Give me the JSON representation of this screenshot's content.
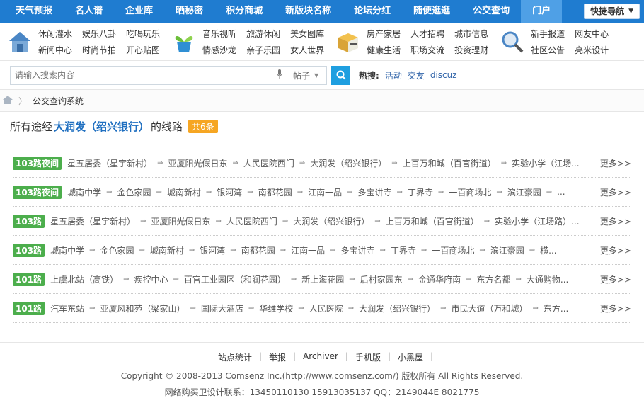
{
  "topnav": {
    "items": [
      "天气预报",
      "名人谱",
      "企业库",
      "晒秘密",
      "积分商城",
      "新版块名称",
      "论坛分红",
      "随便逛逛",
      "公交查询",
      "门户"
    ],
    "quicknav": "快捷导航"
  },
  "categories": [
    {
      "icon": "home-icon",
      "links": [
        "休闲灌水",
        "娱乐八卦",
        "吃喝玩乐",
        "新闻中心",
        "时尚节拍",
        "开心贴图"
      ]
    },
    {
      "icon": "plant-icon",
      "links": [
        "音乐视听",
        "旅游休闲",
        "美女图库",
        "情感沙龙",
        "亲子乐园",
        "女人世界"
      ]
    },
    {
      "icon": "box-icon",
      "links": [
        "房产家居",
        "人才招聘",
        "城市信息",
        "健康生活",
        "职场交流",
        "投资理财"
      ]
    },
    {
      "icon": "magnifier-icon",
      "links": [
        "新手报道",
        "网友中心",
        "社区公告",
        "亮米设计"
      ]
    }
  ],
  "search": {
    "placeholder": "请输入搜索内容",
    "type": "帖子",
    "hot_label": "热搜:",
    "hot": [
      "活动",
      "交友",
      "discuz"
    ]
  },
  "breadcrumb": {
    "current": "公交查询系统"
  },
  "title": {
    "prefix": "所有途经",
    "stop": "大润发（绍兴银行）",
    "suffix": "的线路",
    "count": "共6条"
  },
  "more_label": "更多>>",
  "routes": [
    {
      "name": "103路夜间",
      "stops": [
        "星五居委（星宇新村）",
        "亚厦阳光假日东",
        "人民医院西门",
        "大润发（绍兴银行）",
        "上百万和城（百官街道）",
        "实验小学（江场..."
      ]
    },
    {
      "name": "103路夜间",
      "stops": [
        "城南中学",
        "金色家园",
        "城南新村",
        "银河湾",
        "南都花园",
        "江南一品",
        "多宝讲寺",
        "丁界寺",
        "一百商场北",
        "滨江豪园",
        "..."
      ]
    },
    {
      "name": "103路",
      "stops": [
        "星五居委（星宇新村）",
        "亚厦阳光假日东",
        "人民医院西门",
        "大润发（绍兴银行）",
        "上百万和城（百官街道）",
        "实验小学（江场路）..."
      ]
    },
    {
      "name": "103路",
      "stops": [
        "城南中学",
        "金色家园",
        "城南新村",
        "银河湾",
        "南都花园",
        "江南一品",
        "多宝讲寺",
        "丁界寺",
        "一百商场北",
        "滨江豪园",
        "横..."
      ]
    },
    {
      "name": "101路",
      "stops": [
        "上虞北站（高铁）",
        "疾控中心",
        "百官工业园区（和润花园）",
        "新上海花园",
        "后村家园东",
        "金通华府南",
        "东方名都",
        "大通购物..."
      ]
    },
    {
      "name": "101路",
      "stops": [
        "汽车东站",
        "亚厦风和苑（梁家山）",
        "国际大酒店",
        "华维学校",
        "人民医院",
        "大润发（绍兴银行）",
        "市民大道（万和城）",
        "东方..."
      ]
    }
  ],
  "footer": {
    "links": [
      "站点统计",
      "举报",
      "Archiver",
      "手机版",
      "小黑屋"
    ],
    "copyright": "Copyright © 2008-2013 Comsenz Inc.(http://www.comsenz.com/) 版权所有 All Rights Reserved.",
    "contact": "网络购买卫设计联系：13450110130 15913035137 QQ：2149044E 8021775"
  },
  "colors": {
    "nav": "#1f7cd0",
    "badge": "#4cae4c",
    "count": "#f6a623",
    "search_btn": "#1f9fe0",
    "link": "#1f6fc0"
  }
}
